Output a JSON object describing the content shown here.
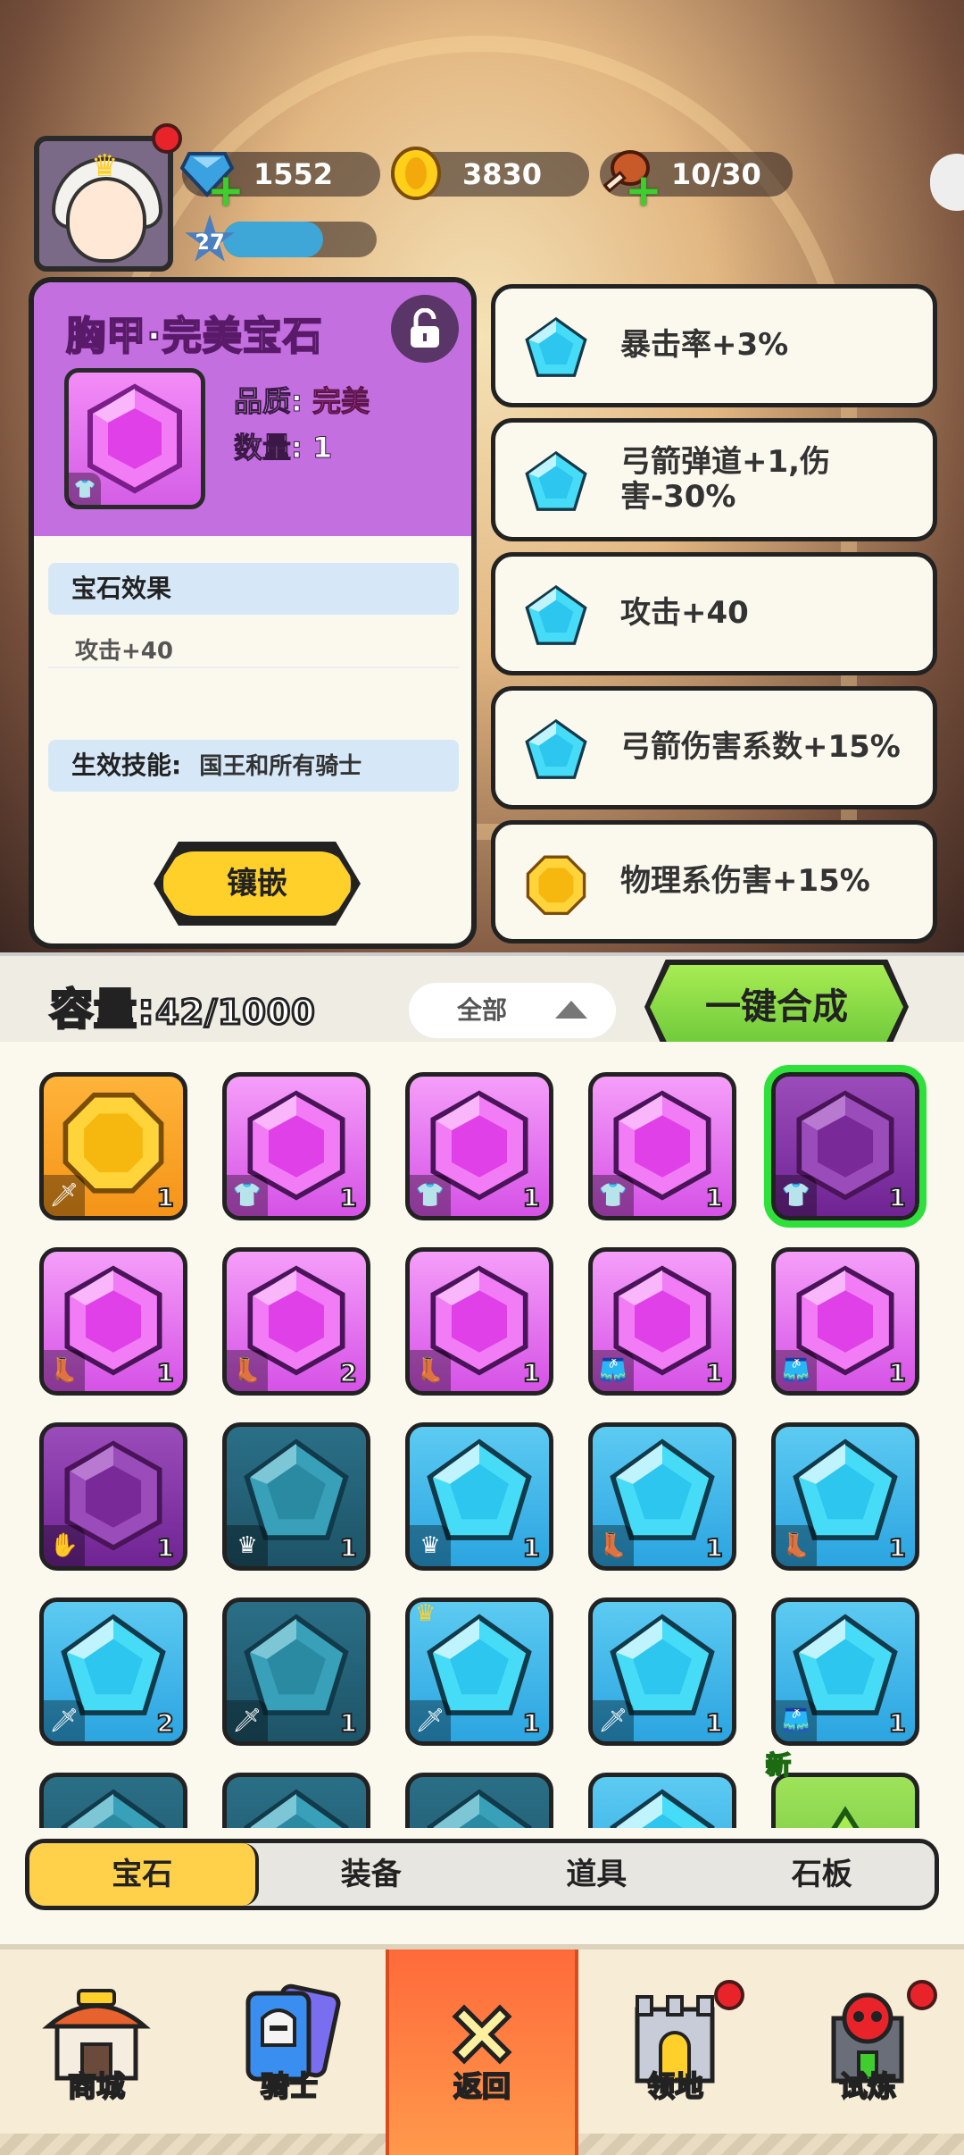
{
  "hud": {
    "gems": "1552",
    "gold": "3830",
    "stamina": "10/30",
    "level": "27",
    "level_progress": 0.65,
    "gem_icon": "blue-gem-icon",
    "gold_icon": "gold-coin-icon",
    "stamina_icon": "meat-icon"
  },
  "detail": {
    "title": "胸甲·完美宝石",
    "quality_label": "品质:",
    "quality_value": "完美",
    "count_label": "数量:",
    "count_value": "1",
    "effect_header": "宝石效果",
    "effect_value": "攻击+40",
    "skill_label": "生效技能:",
    "skill_value": "国王和所有骑士",
    "inlay_button": "镶嵌",
    "lock_icon": "lock-icon"
  },
  "effects": [
    {
      "label": "暴击率+3%",
      "gem": "blue"
    },
    {
      "label": "弓箭弹道+1,伤害-30%",
      "gem": "blue"
    },
    {
      "label": "攻击+40",
      "gem": "blue"
    },
    {
      "label": "弓箭伤害系数+15%",
      "gem": "blue"
    },
    {
      "label": "物理系伤害+15%",
      "gem": "gold"
    }
  ],
  "inventory": {
    "capacity_label": "容量:",
    "capacity_value": "42/1000",
    "filter_label": "全部",
    "merge_button": "一键合成",
    "new_label": "新"
  },
  "grid": [
    {
      "color": "gold",
      "type": "sword",
      "count": "1"
    },
    {
      "color": "pink",
      "type": "armor",
      "count": "1"
    },
    {
      "color": "pink",
      "type": "armor",
      "count": "1"
    },
    {
      "color": "pink",
      "type": "armor",
      "count": "1"
    },
    {
      "color": "darkpurple",
      "type": "armor",
      "count": "1",
      "selected": true
    },
    {
      "color": "pink",
      "type": "boot",
      "count": "1"
    },
    {
      "color": "pink",
      "type": "boot",
      "count": "2"
    },
    {
      "color": "pink",
      "type": "boot",
      "count": "1"
    },
    {
      "color": "pink",
      "type": "pants",
      "count": "1"
    },
    {
      "color": "pink",
      "type": "pants",
      "count": "1"
    },
    {
      "color": "darkpurple",
      "type": "glove",
      "count": "1"
    },
    {
      "color": "teal",
      "type": "crown",
      "count": "1"
    },
    {
      "color": "blue",
      "type": "crown",
      "count": "1"
    },
    {
      "color": "blue",
      "type": "boot",
      "count": "1"
    },
    {
      "color": "blue",
      "type": "boot",
      "count": "1"
    },
    {
      "color": "blue",
      "type": "sword",
      "count": "2"
    },
    {
      "color": "teal",
      "type": "sword",
      "count": "1"
    },
    {
      "color": "blue",
      "type": "sword",
      "count": "1",
      "crown": true
    },
    {
      "color": "blue",
      "type": "sword",
      "count": "1"
    },
    {
      "color": "blue",
      "type": "pants",
      "count": "1"
    },
    {
      "color": "teal",
      "type": "",
      "count": ""
    },
    {
      "color": "teal",
      "type": "",
      "count": ""
    },
    {
      "color": "teal",
      "type": "",
      "count": ""
    },
    {
      "color": "blue",
      "type": "",
      "count": ""
    },
    {
      "color": "green",
      "type": "",
      "count": "",
      "new": true
    }
  ],
  "tabs": [
    {
      "label": "宝石",
      "active": true
    },
    {
      "label": "装备",
      "active": false
    },
    {
      "label": "道具",
      "active": false
    },
    {
      "label": "石板",
      "active": false
    }
  ],
  "nav": [
    {
      "label": "商城",
      "icon": "shop-icon",
      "active": false,
      "badge": false
    },
    {
      "label": "骑士",
      "icon": "knight-card-icon",
      "active": false,
      "badge": false
    },
    {
      "label": "返回",
      "icon": "close-icon",
      "active": true,
      "badge": false
    },
    {
      "label": "领地",
      "icon": "castle-icon",
      "active": false,
      "badge": true
    },
    {
      "label": "试炼",
      "icon": "skull-tower-icon",
      "active": false,
      "badge": true
    }
  ],
  "colors": {
    "pink": "#e66cf0",
    "darkpurple": "#8a3aa8",
    "blue": "#38b8ec",
    "teal": "#2a7d96",
    "gold": "#f7a826",
    "green": "#7ccc3c"
  }
}
